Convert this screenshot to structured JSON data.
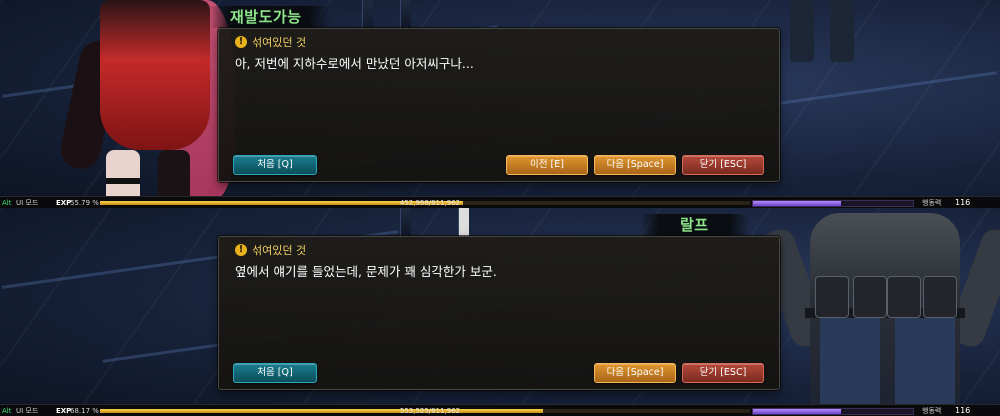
{
  "panels": [
    {
      "speaker": "재발도가능",
      "speaker_color": "#8fe58a",
      "quest_title": "섞여있던 것",
      "dialog_text": "아, 저번에 지하수로에서 만났던 아저씨구나...",
      "buttons": {
        "first": "처음 [Q]",
        "prev": "이전 [E]",
        "next": "다음 [Space]",
        "close": "닫기 [ESC]"
      },
      "status": {
        "alt": "Alt",
        "ui_mode": "UI 모드",
        "exp_label": "EXP",
        "exp_percent": "55.79 %",
        "exp_fraction": 0.5579,
        "exp_value": "452,998/811,962",
        "ap_label": "행동력",
        "ap_value": "116",
        "ap_fraction": 0.55
      }
    },
    {
      "speaker": "랄프",
      "speaker_color": "#8fe58a",
      "quest_title": "섞여있던 것",
      "dialog_text": "옆에서 얘기를 들었는데, 문제가 꽤 심각한가 보군.",
      "buttons": {
        "first": "처음 [Q]",
        "next": "다음 [Space]",
        "close": "닫기 [ESC]"
      },
      "status": {
        "alt": "Alt",
        "ui_mode": "UI 모드",
        "exp_label": "EXP",
        "exp_percent": "68.17 %",
        "exp_fraction": 0.6817,
        "exp_value": "553,525/811,962",
        "ap_label": "행동력",
        "ap_value": "116",
        "ap_fraction": 0.55
      }
    }
  ],
  "colors": {
    "quest_icon": "#e8b21c",
    "button_first": "#1a7d8e",
    "button_nav": "#e0962e",
    "button_close": "#b5493a",
    "exp_bar": "#ffd24a",
    "ap_bar": "#b98cff"
  },
  "icons": {
    "quest": "exclamation-icon"
  }
}
